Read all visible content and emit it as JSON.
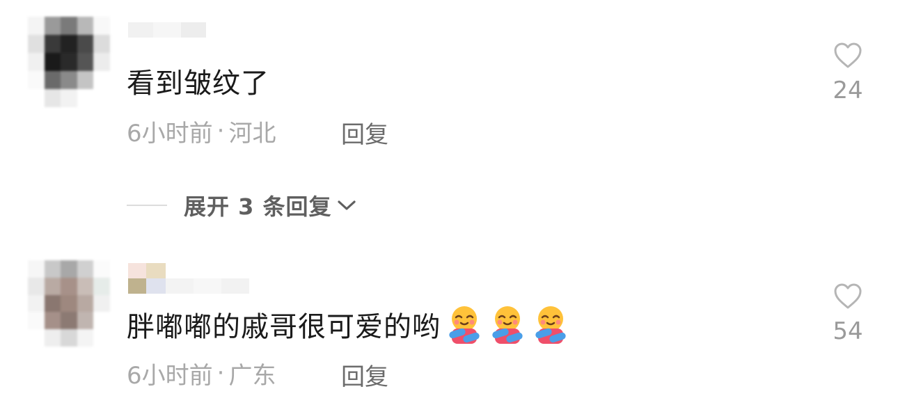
{
  "comments": [
    {
      "text": "看到皱纹了",
      "time": "6小时前",
      "separator": "·",
      "location": "河北",
      "reply_label": "回复",
      "like_count": "24",
      "like_icon": "heart-outline-icon",
      "avatar": "pixelated-avatar"
    },
    {
      "text": "胖嘟嘟的戚哥很可爱的哟",
      "emoji": [
        "hug-emoji",
        "hug-emoji",
        "hug-emoji"
      ],
      "time": "6小时前",
      "separator": "·",
      "location": "广东",
      "reply_label": "回复",
      "like_count": "54",
      "like_icon": "heart-outline-icon",
      "avatar": "pixelated-avatar"
    }
  ],
  "expand_replies": {
    "label": "展开 3 条回复",
    "icon": "chevron-down-icon"
  },
  "colors": {
    "text_primary": "#1a1a1a",
    "text_meta": "#a8a8a8",
    "reply": "#6b6b6b",
    "like_count": "#9a9a9a"
  }
}
